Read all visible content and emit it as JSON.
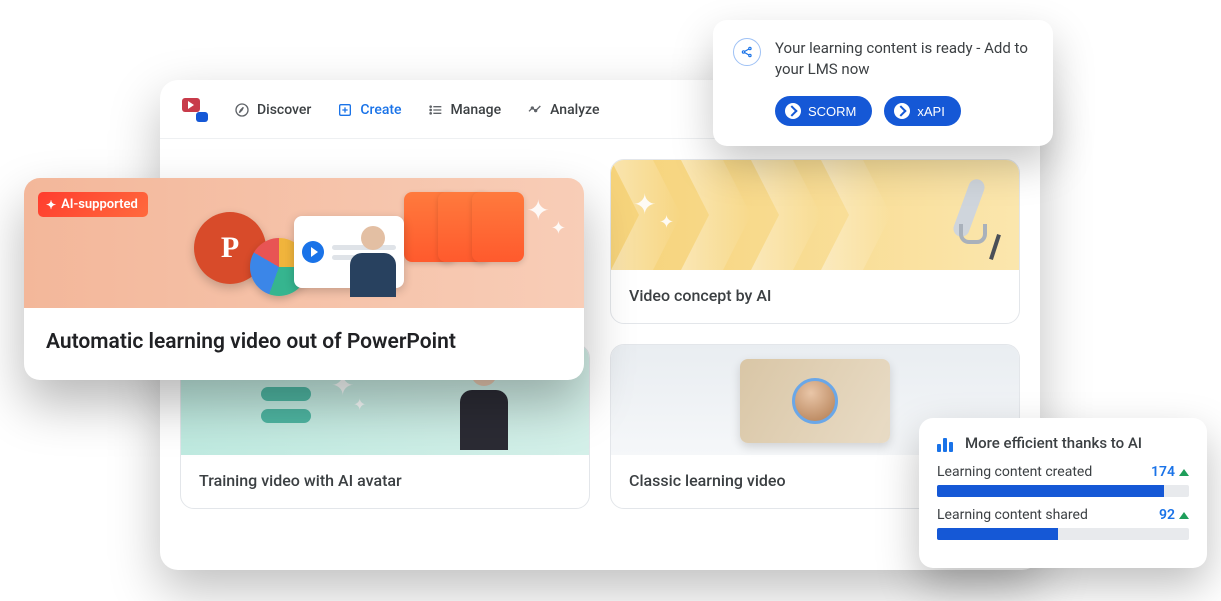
{
  "nav": {
    "discover": "Discover",
    "create": "Create",
    "manage": "Manage",
    "analyze": "Analyze"
  },
  "cards": {
    "featured": {
      "badge": "AI-supported",
      "title": "Automatic learning video out of PowerPoint"
    },
    "concept": {
      "title": "Video concept by AI"
    },
    "avatar": {
      "title": "Training video with AI avatar"
    },
    "classic": {
      "title": "Classic learning video"
    }
  },
  "share_popover": {
    "message": "Your learning content is ready - Add to your LMS now",
    "scorm_label": "SCORM",
    "xapi_label": "xAPI"
  },
  "stats_popover": {
    "heading": "More efficient thanks to AI",
    "metrics": [
      {
        "label": "Learning content created",
        "value": "174",
        "bar_pct": 90
      },
      {
        "label": "Learning content shared",
        "value": "92",
        "bar_pct": 48
      }
    ]
  }
}
